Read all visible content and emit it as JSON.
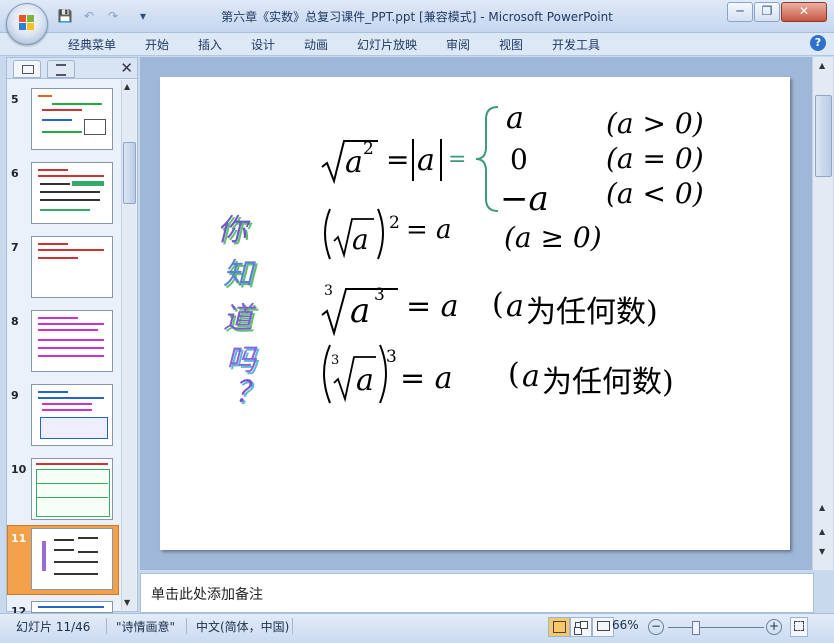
{
  "window": {
    "title": "第六章《实数》总复习课件_PPT.ppt [兼容模式] - Microsoft PowerPoint",
    "minimize": "─",
    "restore": "❐",
    "close": "✕"
  },
  "qat": {
    "save": "💾",
    "undo": "↶",
    "redo": "↷",
    "more": "▾"
  },
  "ribbon_tabs": [
    "经典菜单",
    "开始",
    "插入",
    "设计",
    "动画",
    "幻灯片放映",
    "审阅",
    "视图",
    "开发工具"
  ],
  "panel": {
    "close": "✕"
  },
  "thumbnails": [
    "5",
    "6",
    "7",
    "8",
    "9",
    "10",
    "11",
    "12"
  ],
  "selected_slide": "11",
  "slide": {
    "decor_chars": [
      "你",
      "知",
      "道",
      "吗",
      "？"
    ],
    "rows": {
      "r1_a": "a",
      "r1_2": "2",
      "r1_eq": "=",
      "r1_abs": "a",
      "r1_eq2": "=",
      "case1": "a",
      "case2": "0",
      "case3": "−a",
      "cond1": "(a > 0)",
      "cond2": "(a = 0)",
      "cond3": "(a < 0)",
      "r2_a": "a",
      "r2_2": "2",
      "r2_eq": "= a",
      "r2_cond": "(a ≥ 0)",
      "r3_idx": "3",
      "r3_a": "a",
      "r3_3": "3",
      "r3_eq": "= a",
      "r3_cond_pre": "(",
      "r3_cond_a": "a",
      "r3_cond_txt": "为任何数)",
      "r4_idx": "3",
      "r4_a": "a",
      "r4_3": "3",
      "r4_eq": "= a",
      "r4_cond_pre": "(",
      "r4_cond_a": "a",
      "r4_cond_txt": "为任何数)"
    }
  },
  "notes_placeholder": "单击此处添加备注",
  "status": {
    "slide_counter": "幻灯片 11/46",
    "theme": "\"诗情画意\"",
    "language": "中文(简体，中国)",
    "zoom": "66%",
    "zoom_out": "−",
    "zoom_in": "+"
  }
}
